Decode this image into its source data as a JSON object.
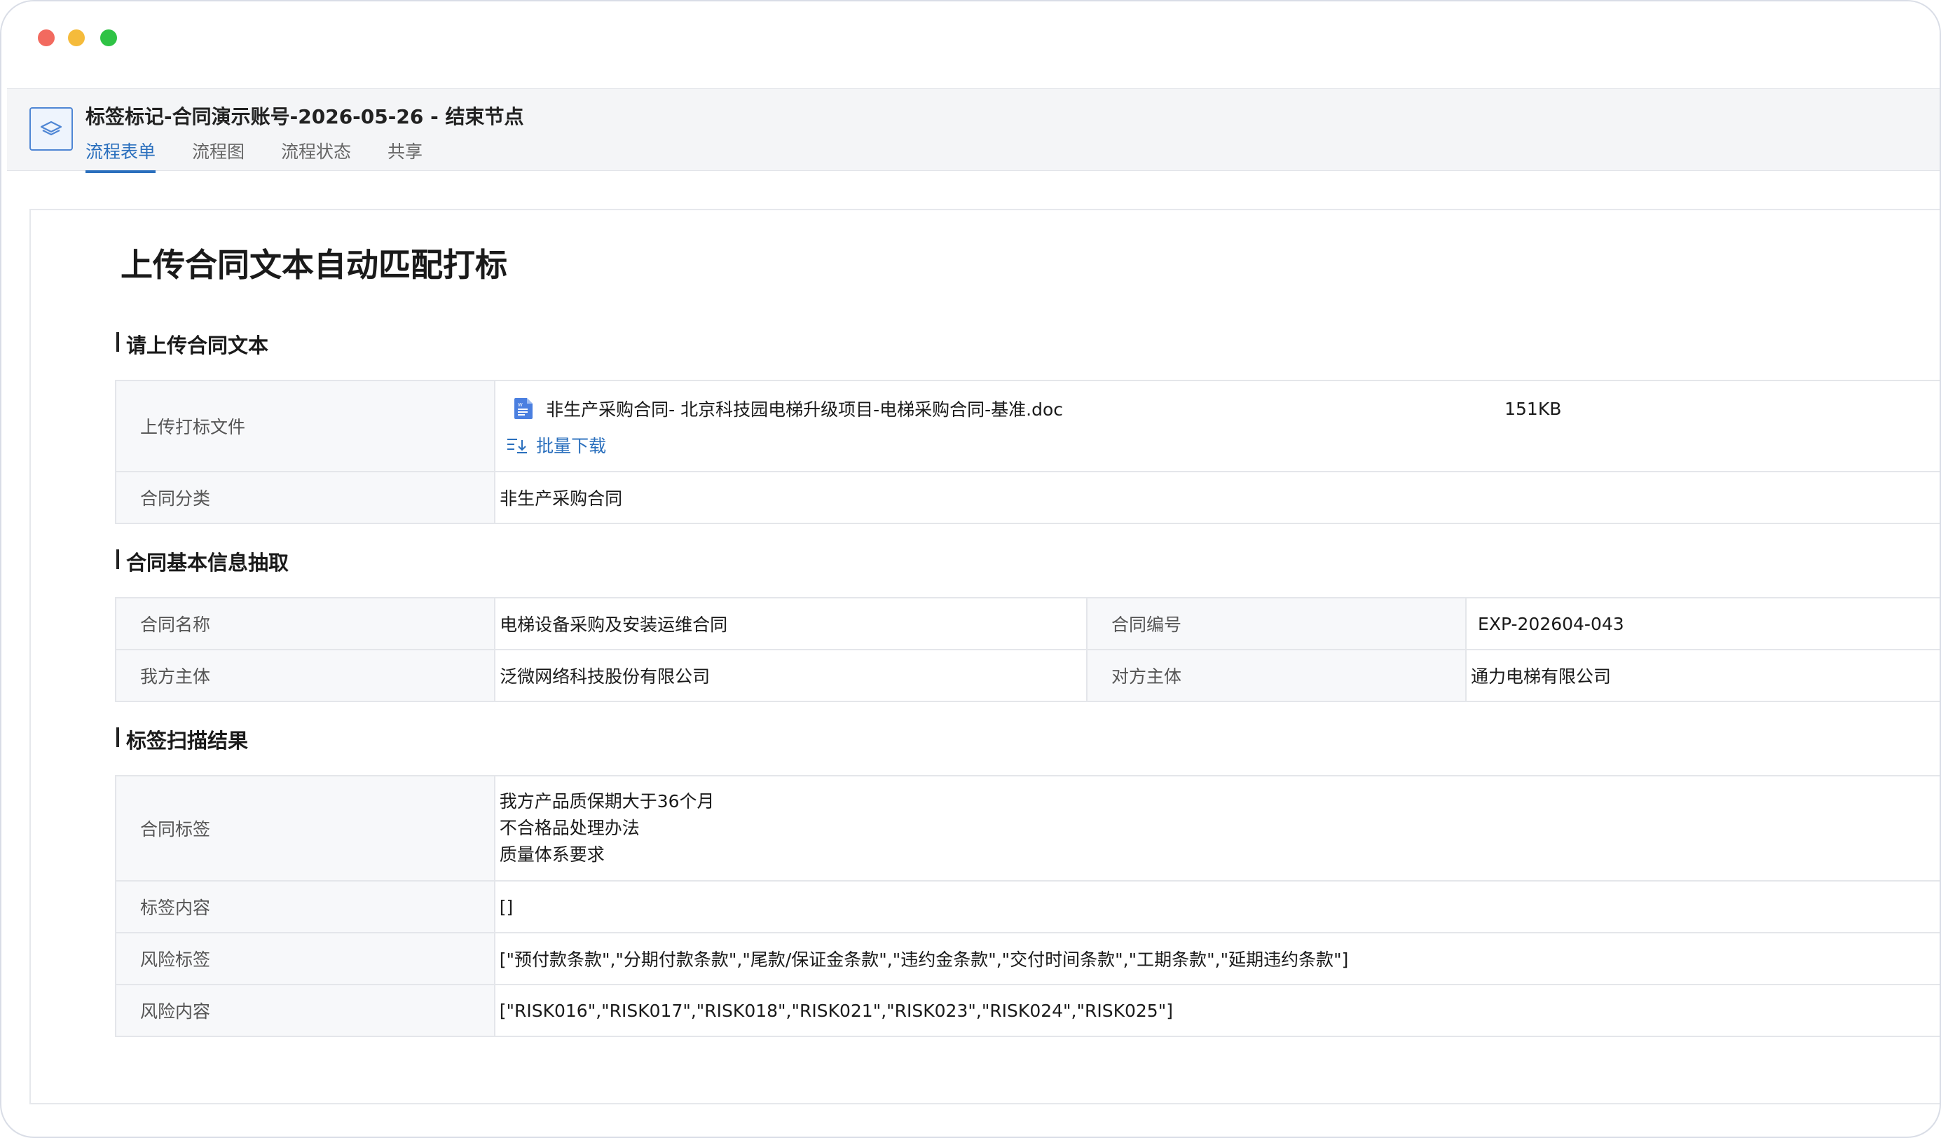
{
  "window": {
    "title": "标签标记-合同演示账号-2026-05-26 - 结束节点"
  },
  "tabs": [
    {
      "label": "流程表单",
      "active": true
    },
    {
      "label": "流程图"
    },
    {
      "label": "流程状态"
    },
    {
      "label": "共享"
    }
  ],
  "page": {
    "title": "上传合同文本自动匹配打标"
  },
  "sections": {
    "upload": {
      "title": "请上传合同文本",
      "file_label": "上传打标文件",
      "file_name": "非生产采购合同- 北京科技园电梯升级项目-电梯采购合同-基准.doc",
      "file_size": "151KB",
      "download_label": "批量下载",
      "category_label": "合同分类",
      "category_value": "非生产采购合同"
    },
    "basic": {
      "title": "合同基本信息抽取",
      "name_label": "合同名称",
      "name_value": "电梯设备采购及安装运维合同",
      "number_label": "合同编号",
      "number_value": "EXP-202604-043",
      "our_label": "我方主体",
      "our_value": "泛微网络科技股份有限公司",
      "their_label": "对方主体",
      "their_value": "通力电梯有限公司"
    },
    "scan": {
      "title": "标签扫描结果",
      "tags_label": "合同标签",
      "tags": [
        "我方产品质保期大于36个月",
        "不合格品处理办法",
        "质量体系要求"
      ],
      "tag_content_label": "标签内容",
      "tag_content_value": "[]",
      "risk_tags_label": "风险标签",
      "risk_tags_value": "[\"预付款条款\",\"分期付款条款\",\"尾款/保证金条款\",\"违约金条款\",\"交付时间条款\",\"工期条款\",\"延期违约条款\"]",
      "risk_content_label": "风险内容",
      "risk_content_value": "[\"RISK016\",\"RISK017\",\"RISK018\",\"RISK021\",\"RISK023\",\"RISK024\",\"RISK025\"]"
    }
  },
  "colors": {
    "accent": "#2a6fbd",
    "label_bg": "#f7f8fa",
    "border": "#e4e6ea"
  },
  "icons": {
    "app": "layers-icon",
    "file": "word-doc-icon",
    "download": "batch-download-icon"
  }
}
